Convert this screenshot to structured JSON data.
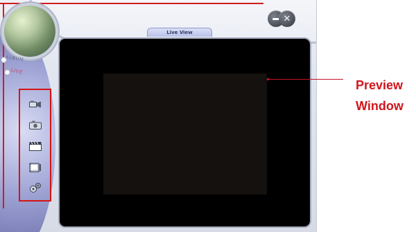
{
  "app": {
    "tab_label": "Live View",
    "modes": {
      "album": "ALBUM",
      "live": "LIVE"
    }
  },
  "window_controls": {
    "minimize_icon": "minimize-icon",
    "close_icon": "close-icon"
  },
  "toolbar": {
    "icons": [
      "video-camera-icon",
      "photo-camera-icon",
      "clapperboard-icon",
      "film-edit-icon",
      "settings-gears-icon"
    ]
  },
  "annotation": {
    "line1": "Preview",
    "line2": "Window",
    "color": "#d0151c"
  },
  "colors": {
    "viewer_bg": "#000000",
    "preview_bg": "#14110f",
    "accent_purple": "#8f97c8",
    "highlight_red": "#d31414"
  }
}
